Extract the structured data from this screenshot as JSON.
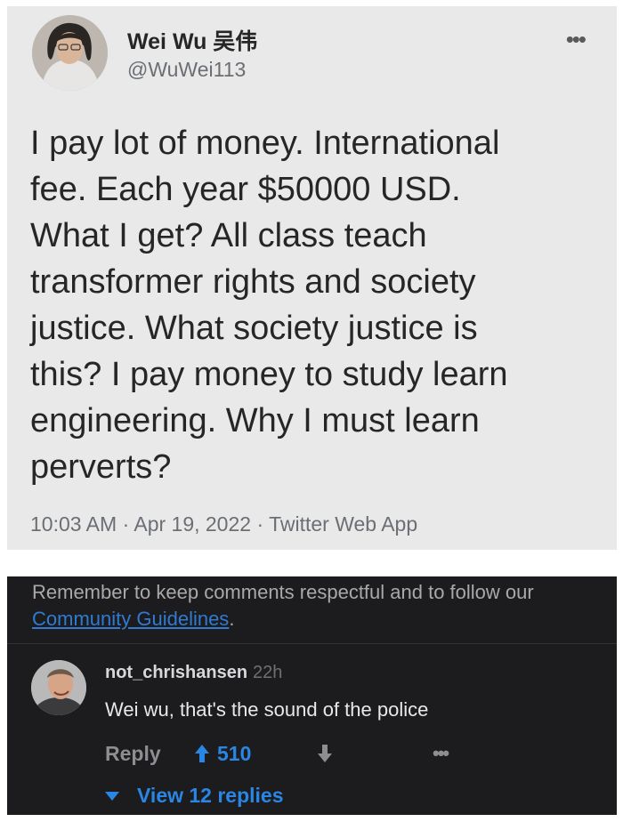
{
  "tweet": {
    "author_name": "Wei Wu 吴伟",
    "author_handle": "@WuWei113",
    "more_icon": "more-horizontal-icon",
    "text": "I pay lot of money. International\nfee. Each year $50000 USD.\nWhat I get? All class teach\ntransformer rights and society\njustice. What society justice is\nthis? I pay money to study learn\nengineering. Why I must learn\nperverts?",
    "meta": "10:03 AM · Apr 19, 2022 · Twitter Web App"
  },
  "comments": {
    "notice_prefix": "Remember to keep comments respectful and to follow our ",
    "notice_link": "Community Guidelines",
    "notice_suffix": ".",
    "items": [
      {
        "username": "not_chrishansen",
        "time": "22h",
        "text": "Wei wu, that's the sound of the police",
        "reply_label": "Reply",
        "upvotes": "510",
        "view_replies_label": "View 12 replies"
      }
    ]
  },
  "colors": {
    "tweet_bg": "#e9e9ea",
    "comments_bg": "#1c1c1e",
    "accent_blue": "#2a86e4"
  }
}
